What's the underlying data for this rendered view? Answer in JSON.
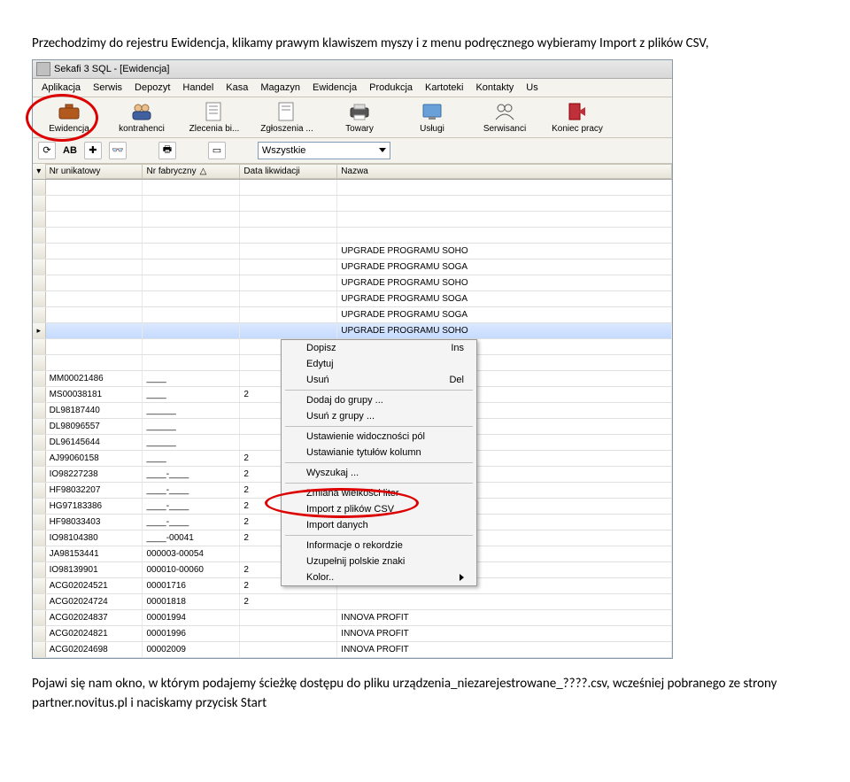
{
  "paragraph_top": "Przechodzimy do rejestru Ewidencja, klikamy prawym klawiszem myszy i z menu podręcznego wybieramy Import z plików CSV,",
  "paragraph_bottom_1": "Pojawi się nam okno, w którym podajemy ścieżkę dostępu do pliku urządzenia_niezarejestrowane_????.csv, wcześniej pobranego ze strony partner.novitus.pl i naciskamy przycisk Start",
  "window": {
    "title": "Sekafi 3 SQL - [Ewidencja]",
    "menus": [
      "Aplikacja",
      "Serwis",
      "Depozyt",
      "Handel",
      "Kasa",
      "Magazyn",
      "Ewidencja",
      "Produkcja",
      "Kartoteki",
      "Kontakty",
      "Us"
    ]
  },
  "toolbar": [
    {
      "label": "Ewidencja",
      "icon": "briefcase"
    },
    {
      "label": "kontrahenci",
      "icon": "people"
    },
    {
      "label": "Zlecenia bi...",
      "icon": "doc"
    },
    {
      "label": "Zgłoszenia ...",
      "icon": "doc"
    },
    {
      "label": "Towary",
      "icon": "printer"
    },
    {
      "label": "Usługi",
      "icon": "screen"
    },
    {
      "label": "Serwisanci",
      "icon": "people2"
    },
    {
      "label": "Koniec pracy",
      "icon": "exit"
    }
  ],
  "filter_combo": "Wszystkie",
  "columns": [
    "Nr unikatowy",
    "Nr fabryczny",
    "Data likwidacji",
    "Nazwa"
  ],
  "rows_top": [
    {
      "a": "",
      "b": "",
      "c": "",
      "d": "UPGRADE PROGRAMU SOHO"
    },
    {
      "a": "",
      "b": "",
      "c": "",
      "d": "UPGRADE PROGRAMU SOGA"
    },
    {
      "a": "",
      "b": "",
      "c": "",
      "d": "UPGRADE PROGRAMU SOHO"
    },
    {
      "a": "",
      "b": "",
      "c": "",
      "d": "UPGRADE PROGRAMU SOGA"
    },
    {
      "a": "",
      "b": "",
      "c": "",
      "d": "UPGRADE PROGRAMU SOGA"
    },
    {
      "a": "",
      "b": "",
      "c": "",
      "d": "UPGRADE PROGRAMU SOHO",
      "sel": true
    }
  ],
  "rows_bottom": [
    {
      "a": "MM00021486",
      "b": "____",
      "c": "",
      "d": ""
    },
    {
      "a": "MS00038181",
      "b": "____",
      "c": "2",
      "d": ""
    },
    {
      "a": "DL98187440",
      "b": "______",
      "c": "",
      "d": ""
    },
    {
      "a": "DL98096557",
      "b": "______",
      "c": "",
      "d": ""
    },
    {
      "a": "DL96145644",
      "b": "______",
      "c": "",
      "d": ""
    },
    {
      "a": "AJ99060158",
      "b": "____",
      "c": "2",
      "d": ""
    },
    {
      "a": "IO98227238",
      "b": "____-____",
      "c": "2",
      "d": ""
    },
    {
      "a": "HF98032207",
      "b": "____-____",
      "c": "2",
      "d": ""
    },
    {
      "a": "HG97183386",
      "b": "____-____",
      "c": "2",
      "d": ""
    },
    {
      "a": "HF98033403",
      "b": "____-____",
      "c": "2",
      "d": ""
    },
    {
      "a": "IO98104380",
      "b": "____-00041",
      "c": "2",
      "d": ""
    },
    {
      "a": "JA98153441",
      "b": "000003-00054",
      "c": "",
      "d": ""
    },
    {
      "a": "IO98139901",
      "b": "000010-00060",
      "c": "2",
      "d": ""
    },
    {
      "a": "ACG02024521",
      "b": "00001716",
      "c": "2",
      "d": ""
    },
    {
      "a": "ACG02024724",
      "b": "00001818",
      "c": "2",
      "d": ""
    },
    {
      "a": "ACG02024837",
      "b": "00001994",
      "c": "",
      "d": "INNOVA PROFIT"
    },
    {
      "a": "ACG02024821",
      "b": "00001996",
      "c": "",
      "d": "INNOVA PROFIT"
    },
    {
      "a": "ACG02024698",
      "b": "00002009",
      "c": "",
      "d": "INNOVA PROFIT"
    }
  ],
  "context": {
    "dopisz": "Dopisz",
    "dopisz_key": "Ins",
    "edytuj": "Edytuj",
    "usun": "Usuń",
    "usun_key": "Del",
    "dodaj_grupy": "Dodaj do grupy ...",
    "usun_grupy": "Usuń z grupy ...",
    "ust_widocz": "Ustawienie widoczności pól",
    "ust_tytul": "Ustawianie tytułów kolumn",
    "wyszukaj": "Wyszukaj ...",
    "zmiana": "Zmiana wielkości liter",
    "import_csv": "Import z plików CSV",
    "import_danych": "Import danych",
    "info_rec": "Informacje o rekordzie",
    "uzupelnij": "Uzupełnij polskie znaki",
    "kolor": "Kolor.."
  }
}
